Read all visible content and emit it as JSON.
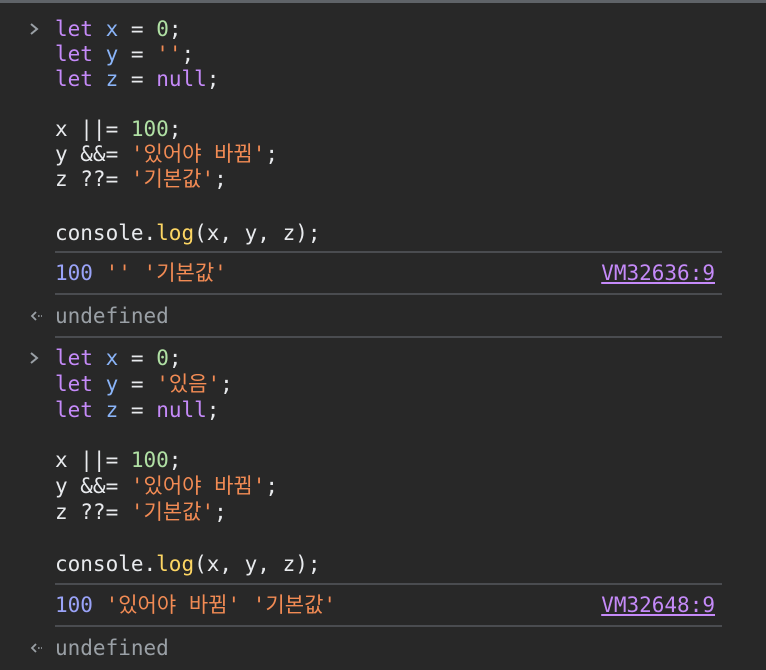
{
  "entries": [
    {
      "code": {
        "l1": {
          "kw": "let",
          "var": "x",
          "eq": " = ",
          "val": "0",
          "semi": ";"
        },
        "l2": {
          "kw": "let",
          "var": "y",
          "eq": " = ",
          "val": "''",
          "semi": ";"
        },
        "l3": {
          "kw": "let",
          "var": "z",
          "eq": " = ",
          "val": "null",
          "semi": ";"
        },
        "l4": {
          "lhs": "x ||= ",
          "val": "100",
          "semi": ";"
        },
        "l5": {
          "lhs": "y &&= ",
          "val": "'있어야 바뀜'",
          "semi": ";"
        },
        "l6": {
          "lhs": "z ??= ",
          "val": "'기본값'",
          "semi": ";"
        },
        "l7": {
          "obj": "console.",
          "fn": "log",
          "args": "(x, y, z);"
        }
      },
      "output": {
        "num": "100",
        "y": "''",
        "z": "'기본값'",
        "source": "VM32636:9"
      },
      "return_value": "undefined"
    },
    {
      "code": {
        "l1": {
          "kw": "let",
          "var": "x",
          "eq": " = ",
          "val": "0",
          "semi": ";"
        },
        "l2": {
          "kw": "let",
          "var": "y",
          "eq": " = ",
          "val": "'있음'",
          "semi": ";"
        },
        "l3": {
          "kw": "let",
          "var": "z",
          "eq": " = ",
          "val": "null",
          "semi": ";"
        },
        "l4": {
          "lhs": "x ||= ",
          "val": "100",
          "semi": ";"
        },
        "l5": {
          "lhs": "y &&= ",
          "val": "'있어야 바뀜'",
          "semi": ";"
        },
        "l6": {
          "lhs": "z ??= ",
          "val": "'기본값'",
          "semi": ";"
        },
        "l7": {
          "obj": "console.",
          "fn": "log",
          "args": "(x, y, z);"
        }
      },
      "output": {
        "num": "100",
        "y": "'있어야 바뀜'",
        "z": "'기본값'",
        "source": "VM32648:9"
      },
      "return_value": "undefined"
    }
  ],
  "icons": {
    "prompt": "chevron-right-icon",
    "return": "return-arrow-icon"
  },
  "colors": {
    "background": "#282828",
    "keyword": "#c58af9",
    "variable": "#8ab4f8",
    "number": "#b0e0a4",
    "string": "#f28b54",
    "function": "#fdd663",
    "muted": "#9aa0a6"
  }
}
